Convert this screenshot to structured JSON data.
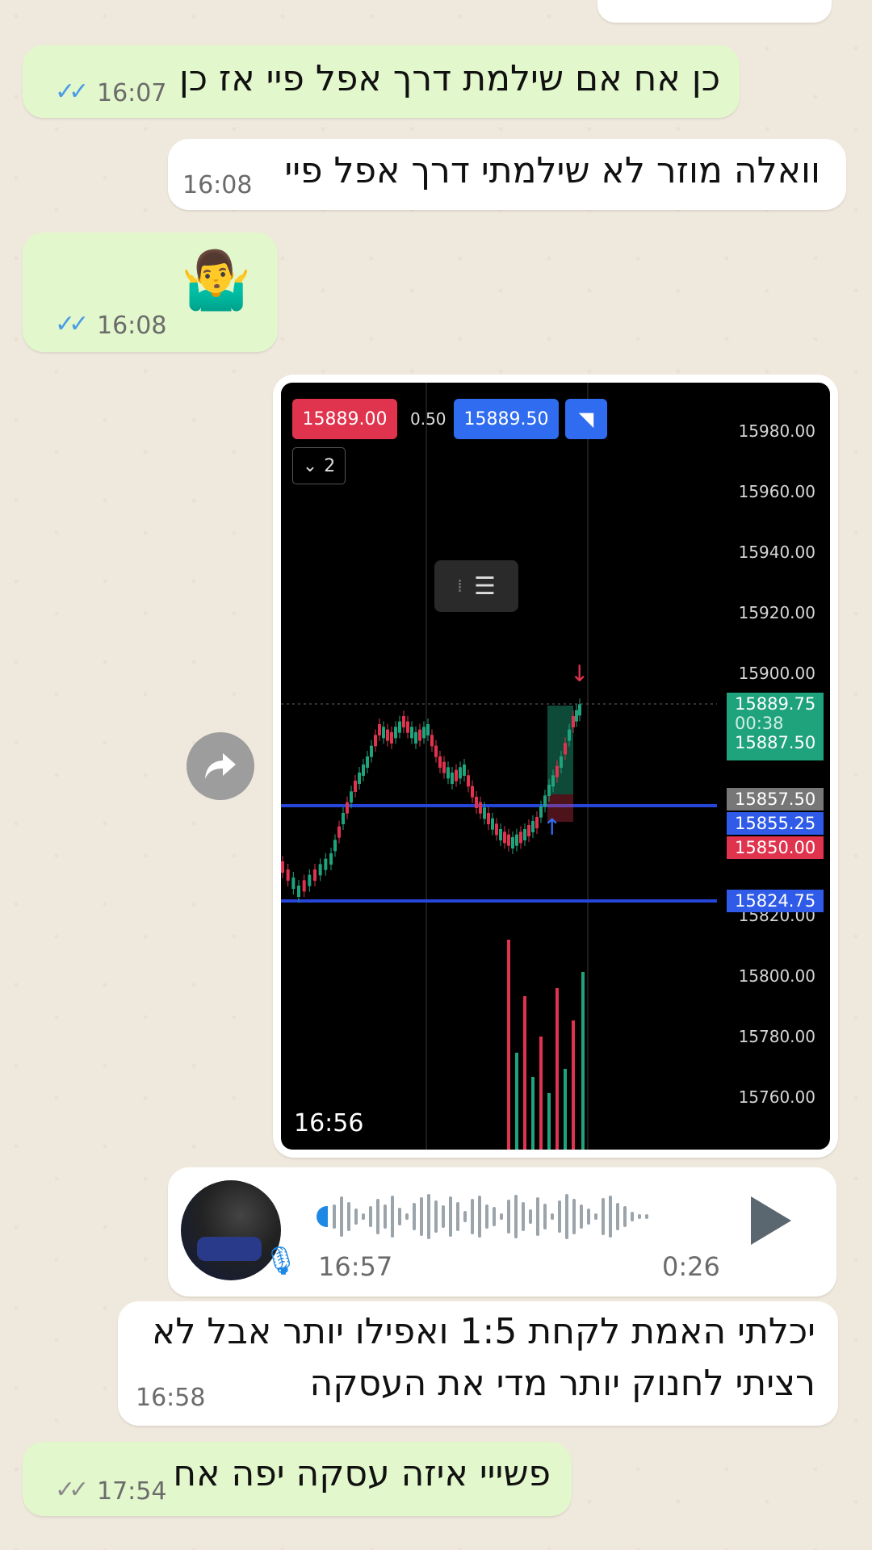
{
  "messages": [
    {
      "text": "כן אח אם שילמת דרך אפל פיי אז כן",
      "time": "16:07",
      "ticks": "✓✓"
    },
    {
      "text": "וואלה מוזר לא שילמתי דרך אפל פיי",
      "time": "16:08"
    },
    {
      "emoji": "🤷‍♂️",
      "time": "16:08",
      "ticks": "✓✓"
    }
  ],
  "chart_msg": {
    "time": "16:56",
    "bid": "15889.00",
    "spread": "0.50",
    "ask": "15889.50",
    "layers": "2",
    "y_ticks": [
      "15980.00",
      "15960.00",
      "15940.00",
      "15920.00",
      "15900.00",
      "15820.00",
      "15800.00",
      "15780.00",
      "15760.00"
    ],
    "tags": {
      "last": "15889.75",
      "countdown": "00:38",
      "last2": "15887.50",
      "gray": "15857.50",
      "blue1": "15855.25",
      "red": "15850.00",
      "blue2": "15824.75"
    },
    "colors": {
      "up": "#1fa37c",
      "down": "#e0334d",
      "line": "#2546d8",
      "bid": "#e0334d",
      "ask": "#2f6cf0"
    }
  },
  "voice": {
    "time": "16:57",
    "duration": "0:26"
  },
  "messages2": [
    {
      "line1": "יכלתי האמת לקחת 1:5 ואפילו יותר אבל לא",
      "line2": "רציתי לחנוק יותר מדי את העסקה",
      "time": "16:58"
    },
    {
      "text": "פשייי איזה עסקה יפה אח",
      "time": "17:54",
      "ticks": "✓✓"
    }
  ]
}
